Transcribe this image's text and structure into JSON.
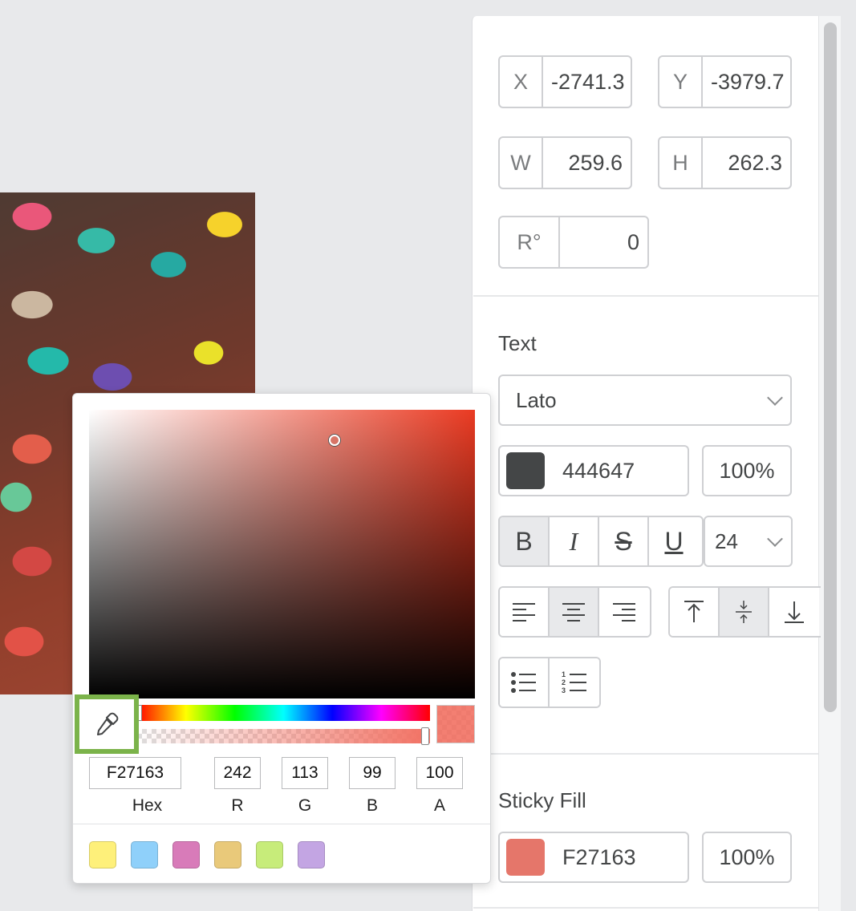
{
  "transform": {
    "x": {
      "label": "X",
      "value": "-2741.3"
    },
    "y": {
      "label": "Y",
      "value": "-3979.7"
    },
    "w": {
      "label": "W",
      "value": "259.6"
    },
    "h": {
      "label": "H",
      "value": "262.3"
    },
    "r": {
      "label": "R°",
      "value": "0"
    }
  },
  "text_section": {
    "title": "Text",
    "font": "Lato",
    "color_hex": "444647",
    "color_swatch": "#444647",
    "opacity": "100%",
    "font_size": "24",
    "style_buttons": [
      {
        "name": "bold",
        "glyph": "B",
        "active": true
      },
      {
        "name": "italic",
        "glyph": "I",
        "active": false
      },
      {
        "name": "strikethrough",
        "glyph": "S",
        "active": false
      },
      {
        "name": "underline",
        "glyph": "U",
        "active": false
      }
    ],
    "align_active": "center",
    "valign_active": "middle"
  },
  "sticky_fill": {
    "title": "Sticky Fill",
    "color_hex": "F27163",
    "color_swatch": "#e5766a",
    "opacity": "100%"
  },
  "color_picker": {
    "hex": "F27163",
    "r": "242",
    "g": "113",
    "b": "99",
    "a": "100",
    "labels": {
      "hex": "Hex",
      "r": "R",
      "g": "G",
      "b": "B",
      "a": "A"
    },
    "presets": [
      "#fef07a",
      "#8fd0fa",
      "#d87bb9",
      "#e9c97a",
      "#c7ec7a",
      "#c3a5e3"
    ]
  },
  "colors": {
    "accent_highlight": "#7bb34a",
    "border": "#cfd0d3",
    "text": "#444647"
  }
}
